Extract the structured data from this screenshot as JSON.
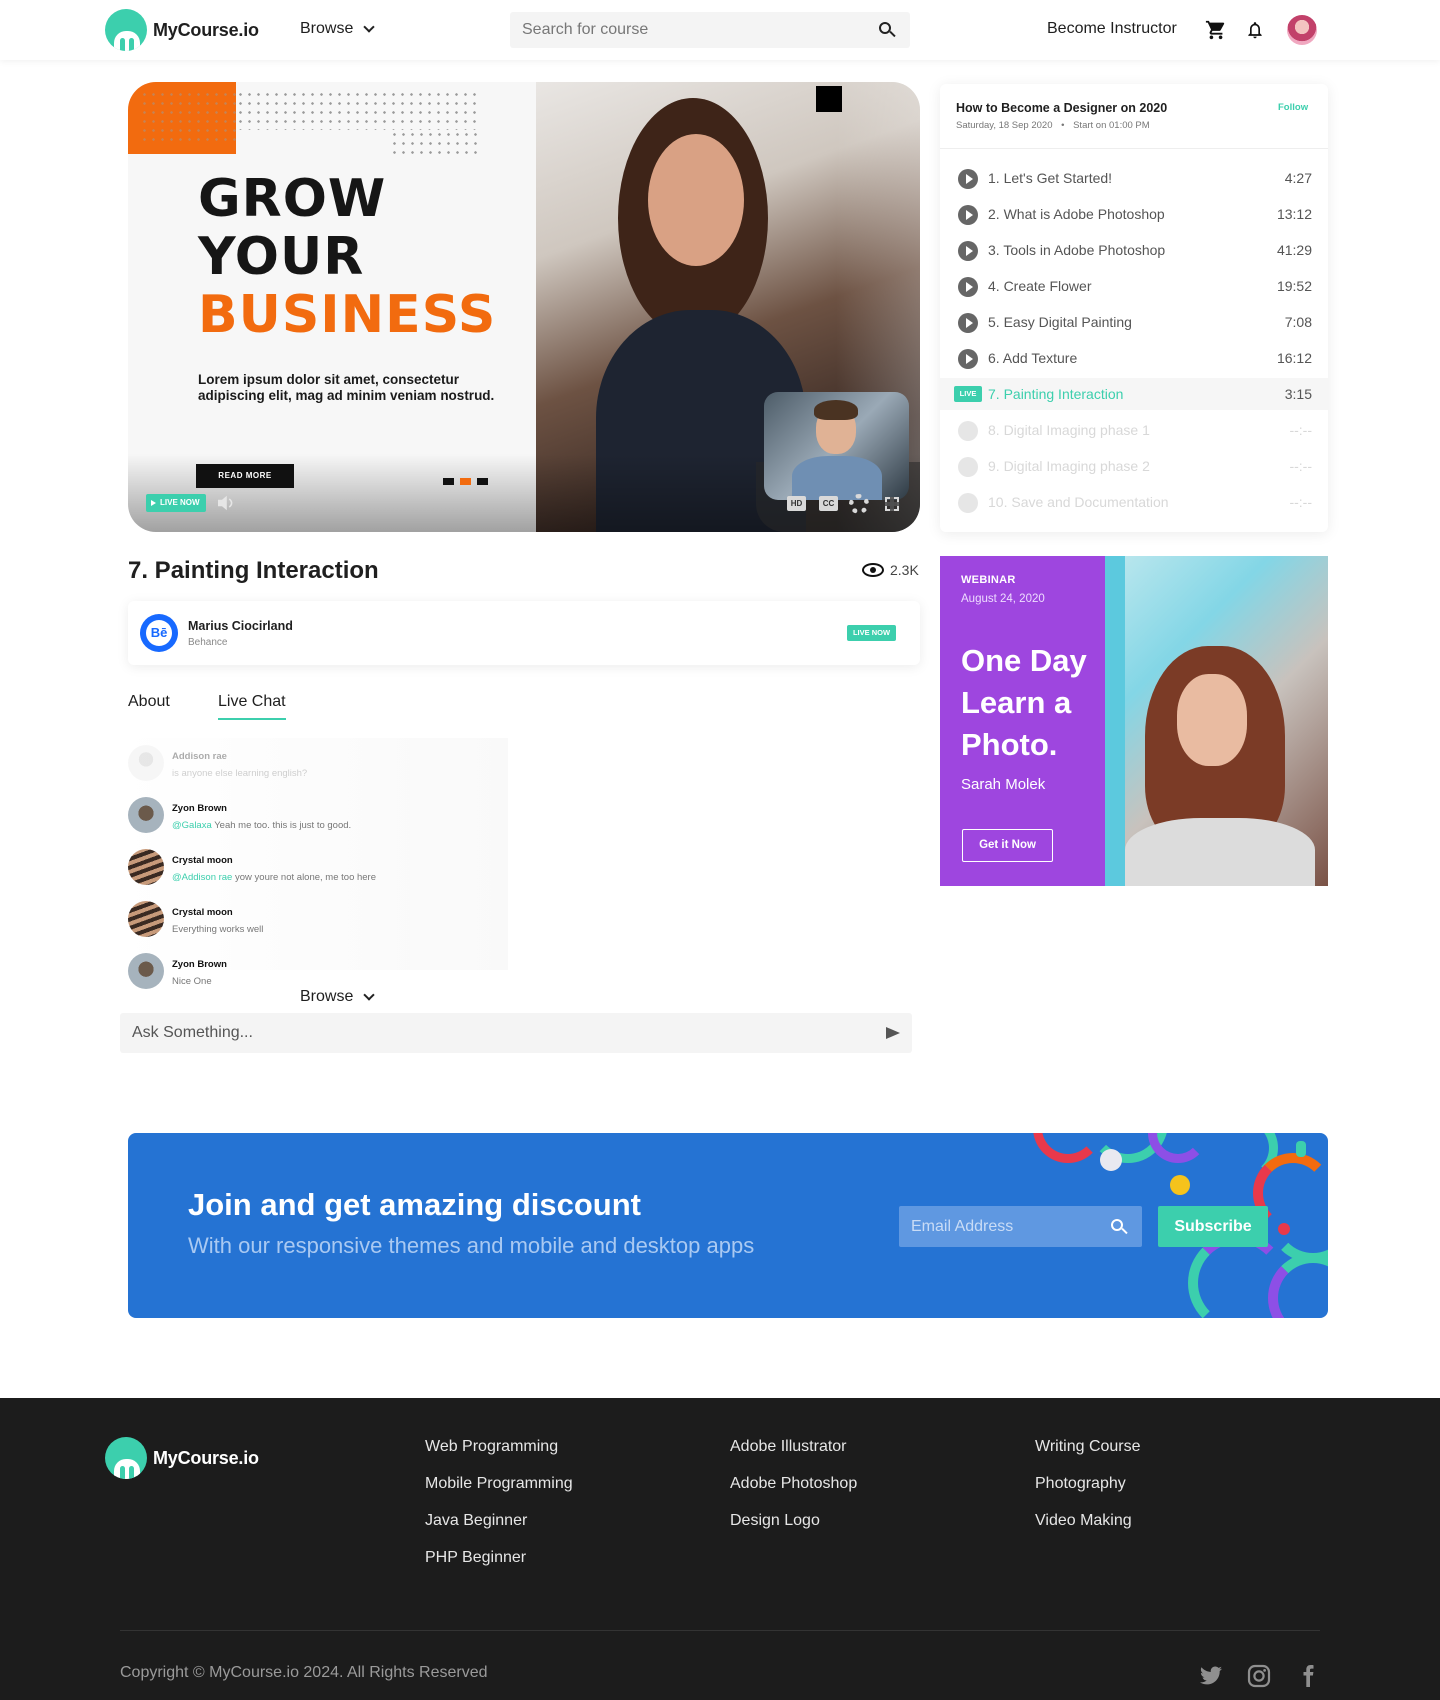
{
  "brand": {
    "name": "MyCourse.io",
    "accent": "#3ccfad"
  },
  "nav": {
    "browse_label": "Browse",
    "search_placeholder": "Search for course",
    "become_instructor": "Become Instructor",
    "icons": [
      "cart-icon",
      "bell-icon",
      "avatar"
    ]
  },
  "video": {
    "headline_1": "GROW",
    "headline_2": "YOUR",
    "headline_3": "BUSINESS",
    "body": "Lorem ipsum dolor sit amet, consectetur adipiscing elit, mag ad minim veniam nostrud.",
    "read_more": "READ MORE",
    "live_badge": "LIVE NOW",
    "hd_label": "HD",
    "cc_label": "CC",
    "slide_index": 2,
    "slide_count": 3
  },
  "lesson": {
    "title": "7. Painting Interaction",
    "views": "2.3K",
    "instructor_name": "Marius Ciocirland",
    "instructor_org": "Behance",
    "instructor_logo": "Bē",
    "live_tag": "LIVE NOW"
  },
  "tabs": [
    {
      "label": "About",
      "active": false
    },
    {
      "label": "Live Chat",
      "active": true
    }
  ],
  "chat": [
    {
      "name": "Addison rae",
      "mention": "",
      "text": "is anyone else learning english?",
      "faded": true
    },
    {
      "name": "Zyon Brown",
      "mention": "@Galaxa",
      "text": " Yeah me too. this is just to good."
    },
    {
      "name": "Crystal moon",
      "mention": "@Addison rae",
      "text": " yow youre not alone, me too here"
    },
    {
      "name": "Crystal moon",
      "mention": "",
      "text": "Everything works well"
    },
    {
      "name": "Zyon Brown",
      "mention": "",
      "text": "Nice One"
    }
  ],
  "chat_browse": "Browse",
  "ask_placeholder": "Ask Something...",
  "playlist": {
    "title": "How to Become a Designer on 2020",
    "date": "Saturday, 18 Sep 2020",
    "start": "Start on 01:00 PM",
    "follow": "Follow",
    "live_tag": "LIVE",
    "items": [
      {
        "label": "1. Let's Get Started!",
        "duration": "4:27",
        "state": "done"
      },
      {
        "label": "2. What is Adobe Photoshop",
        "duration": "13:12",
        "state": "done"
      },
      {
        "label": "3. Tools in Adobe Photoshop",
        "duration": "41:29",
        "state": "done"
      },
      {
        "label": "4. Create Flower",
        "duration": "19:52",
        "state": "done"
      },
      {
        "label": "5. Easy Digital Painting",
        "duration": "7:08",
        "state": "done"
      },
      {
        "label": "6. Add Texture",
        "duration": "16:12",
        "state": "done"
      },
      {
        "label": "7. Painting Interaction",
        "duration": "3:15",
        "state": "live"
      },
      {
        "label": "8. Digital Imaging phase 1",
        "duration": "--:--",
        "state": "locked"
      },
      {
        "label": "9. Digital Imaging phase 2",
        "duration": "--:--",
        "state": "locked"
      },
      {
        "label": "10. Save and Documentation",
        "duration": "--:--",
        "state": "locked"
      }
    ]
  },
  "webinar": {
    "kicker": "WEBINAR",
    "date": "August 24, 2020",
    "title": "One Day Learn a Photo.",
    "speaker": "Sarah Molek",
    "button": "Get it Now",
    "color": "#9e46df"
  },
  "newsletter": {
    "title": "Join and get amazing discount",
    "subtitle": "With our responsive themes and mobile and desktop apps",
    "email_placeholder": "Email Address",
    "button": "Subscribe",
    "color": "#2573d3"
  },
  "footer": {
    "brand": "MyCourse.io",
    "col1": [
      "Web Programming",
      "Mobile Programming",
      "Java Beginner",
      "PHP Beginner"
    ],
    "col2": [
      "Adobe Illustrator",
      "Adobe Photoshop",
      "Design Logo"
    ],
    "col3": [
      "Writing Course",
      "Photography",
      "Video Making"
    ],
    "copyright": "Copyright © MyCourse.io 2024. All Rights Reserved",
    "social": [
      "twitter-icon",
      "instagram-icon",
      "facebook-icon"
    ]
  }
}
